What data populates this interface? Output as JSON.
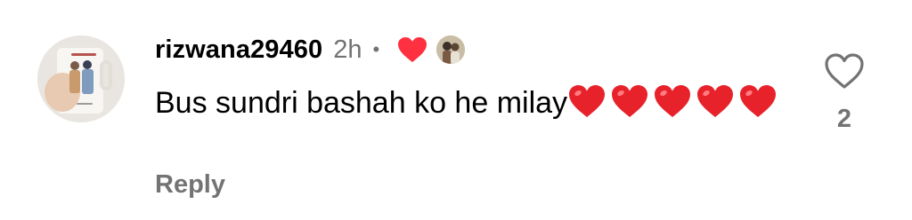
{
  "comment": {
    "username": "rizwana29460",
    "timestamp": "2h",
    "separator": "•",
    "creator_liked": true,
    "text": "Bus sundri bashah ko he milay",
    "emoji_hearts": [
      "❤️",
      "❤️",
      "❤️",
      "❤️",
      "❤️"
    ],
    "reply_label": "Reply",
    "like_count": "2"
  },
  "icons": {
    "like": "heart-outline-icon",
    "liked_by_creator": "red-heart-icon",
    "emoji": "red-heart-emoji"
  },
  "colors": {
    "heart_red": "#ff3040",
    "secondary_text": "#737373",
    "primary_text": "#000000"
  }
}
